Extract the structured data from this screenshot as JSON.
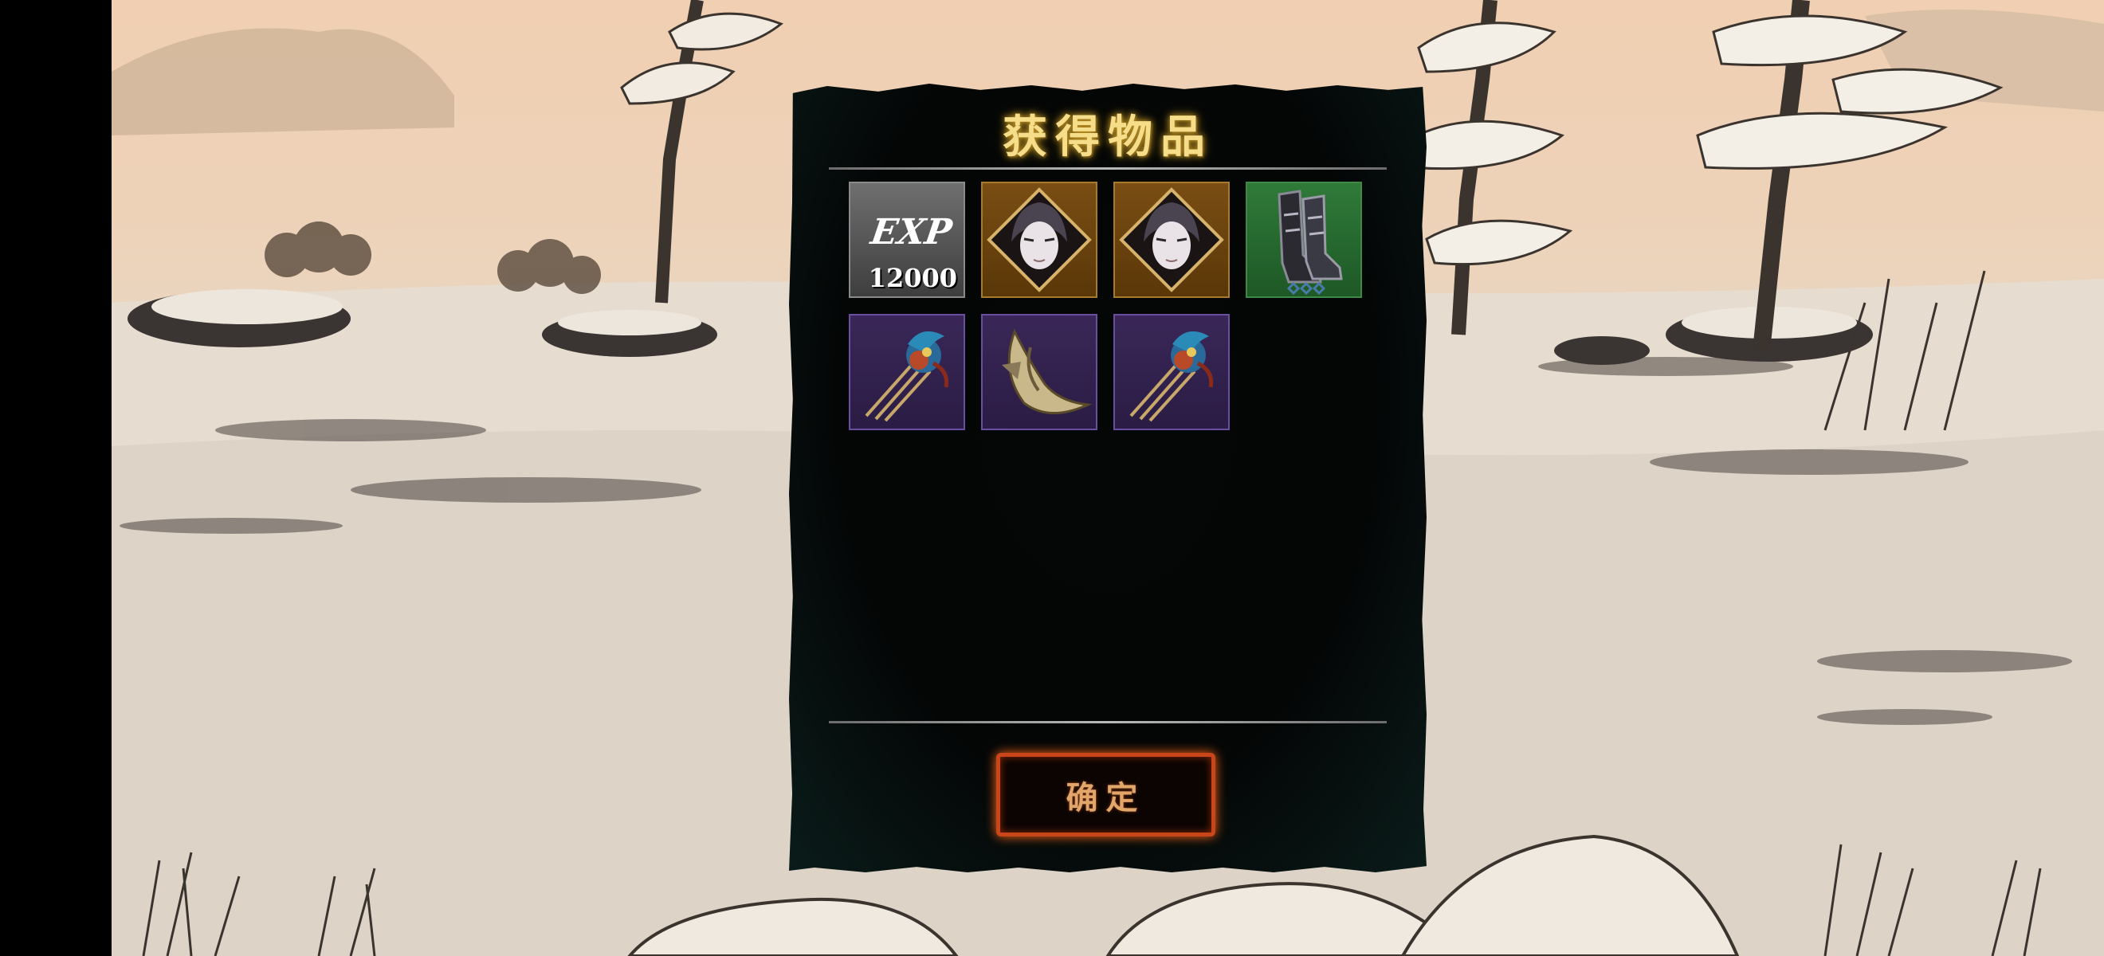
{
  "dialog": {
    "title": "获得物品",
    "confirm_label": "确定"
  },
  "items": [
    {
      "type": "exp",
      "label": "EXP",
      "amount": "12000",
      "rarity": "gray",
      "icon": "exp-icon"
    },
    {
      "type": "portrait",
      "rarity": "gold",
      "icon": "hooded-character-portrait-icon"
    },
    {
      "type": "portrait",
      "rarity": "gold",
      "icon": "hooded-character-portrait-icon"
    },
    {
      "type": "equipment",
      "rarity": "green",
      "icon": "armored-boots-icon"
    },
    {
      "type": "equipment",
      "rarity": "purple",
      "icon": "feathered-hairpin-icon"
    },
    {
      "type": "equipment",
      "rarity": "purple",
      "icon": "curved-blade-icon"
    },
    {
      "type": "equipment",
      "rarity": "purple",
      "icon": "feathered-hairpin-icon"
    }
  ],
  "colors": {
    "title_gold": "#f5dd8a",
    "rarity_gold": "#7a4e14",
    "rarity_green": "#2f7a39",
    "rarity_purple": "#3a2758",
    "button_border": "#c9461a"
  }
}
